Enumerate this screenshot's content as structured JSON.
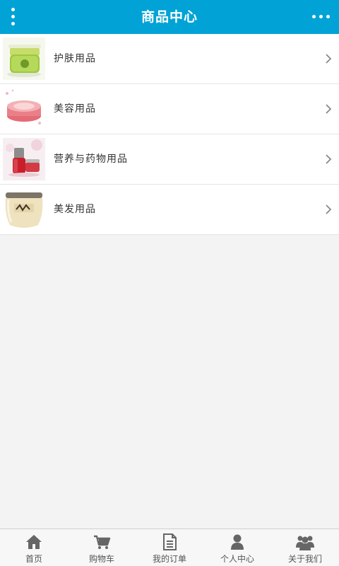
{
  "header": {
    "title": "商品中心",
    "menu_icon": "kebab-vertical-icon",
    "more_icon": "ellipsis-horizontal-icon",
    "color": "#01a3d6"
  },
  "categories": [
    {
      "label": "护肤用品",
      "thumb": "green-cream-jar"
    },
    {
      "label": "美容用品",
      "thumb": "pink-powder-compact"
    },
    {
      "label": "营养与药物用品",
      "thumb": "red-serum-bottle"
    },
    {
      "label": "美发用品",
      "thumb": "cream-hair-mask-jar"
    }
  ],
  "tabbar": [
    {
      "label": "首页",
      "icon": "home-icon"
    },
    {
      "label": "购物车",
      "icon": "cart-icon"
    },
    {
      "label": "我的订单",
      "icon": "document-icon"
    },
    {
      "label": "个人中心",
      "icon": "user-icon"
    },
    {
      "label": "关于我们",
      "icon": "group-icon"
    }
  ]
}
